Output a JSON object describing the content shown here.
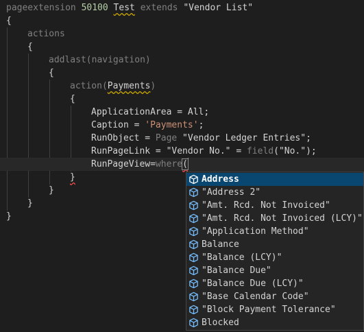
{
  "code": {
    "line1": {
      "kw": "pageextension",
      "num": "50100",
      "name": "Test",
      "ext": "extends",
      "target": "\"Vendor List\""
    },
    "line2": "{",
    "line3": "actions",
    "line4": "{",
    "line5": {
      "fn": "addlast",
      "arg": "(navigation)"
    },
    "line6": "{",
    "line7": {
      "fn": "action",
      "open": "(",
      "name": "Payments",
      "close": ")"
    },
    "line8": "{",
    "line9": "ApplicationArea = All;",
    "line10": {
      "prop": "Caption = ",
      "value": "'Payments'",
      "end": ";"
    },
    "line11": {
      "prop": "RunObject = ",
      "kw": "Page",
      "value": " \"Vendor Ledger Entries\";"
    },
    "line12": {
      "prop": "RunPageLink = \"Vendor No.\" = ",
      "fn": "field",
      "value": "(\"No.\");"
    },
    "line13": {
      "prop": "RunPageView=",
      "kw": "where",
      "paren": "("
    },
    "line14": "}",
    "line15": "}",
    "line16": "}",
    "line17": "}"
  },
  "suggest": {
    "items": [
      {
        "label": "Address",
        "icon": "field-icon"
      },
      {
        "label": "\"Address 2\"",
        "icon": "field-icon"
      },
      {
        "label": "\"Amt. Rcd. Not Invoiced\"",
        "icon": "field-icon"
      },
      {
        "label": "\"Amt. Rcd. Not Invoiced (LCY)\"",
        "icon": "field-icon"
      },
      {
        "label": "\"Application Method\"",
        "icon": "field-icon"
      },
      {
        "label": "Balance",
        "icon": "field-icon"
      },
      {
        "label": "\"Balance (LCY)\"",
        "icon": "field-icon"
      },
      {
        "label": "\"Balance Due\"",
        "icon": "field-icon"
      },
      {
        "label": "\"Balance Due (LCY)\"",
        "icon": "field-icon"
      },
      {
        "label": "\"Base Calendar Code\"",
        "icon": "field-icon"
      },
      {
        "label": "\"Block Payment Tolerance\"",
        "icon": "field-icon"
      },
      {
        "label": "Blocked",
        "icon": "field-icon"
      }
    ],
    "selected_index": 0
  },
  "colors": {
    "background": "#1e1e1e",
    "keyword": "#808080",
    "number": "#b5cea8",
    "string": "#ce9178",
    "function": "#dcdcaa",
    "selection": "#094771"
  }
}
